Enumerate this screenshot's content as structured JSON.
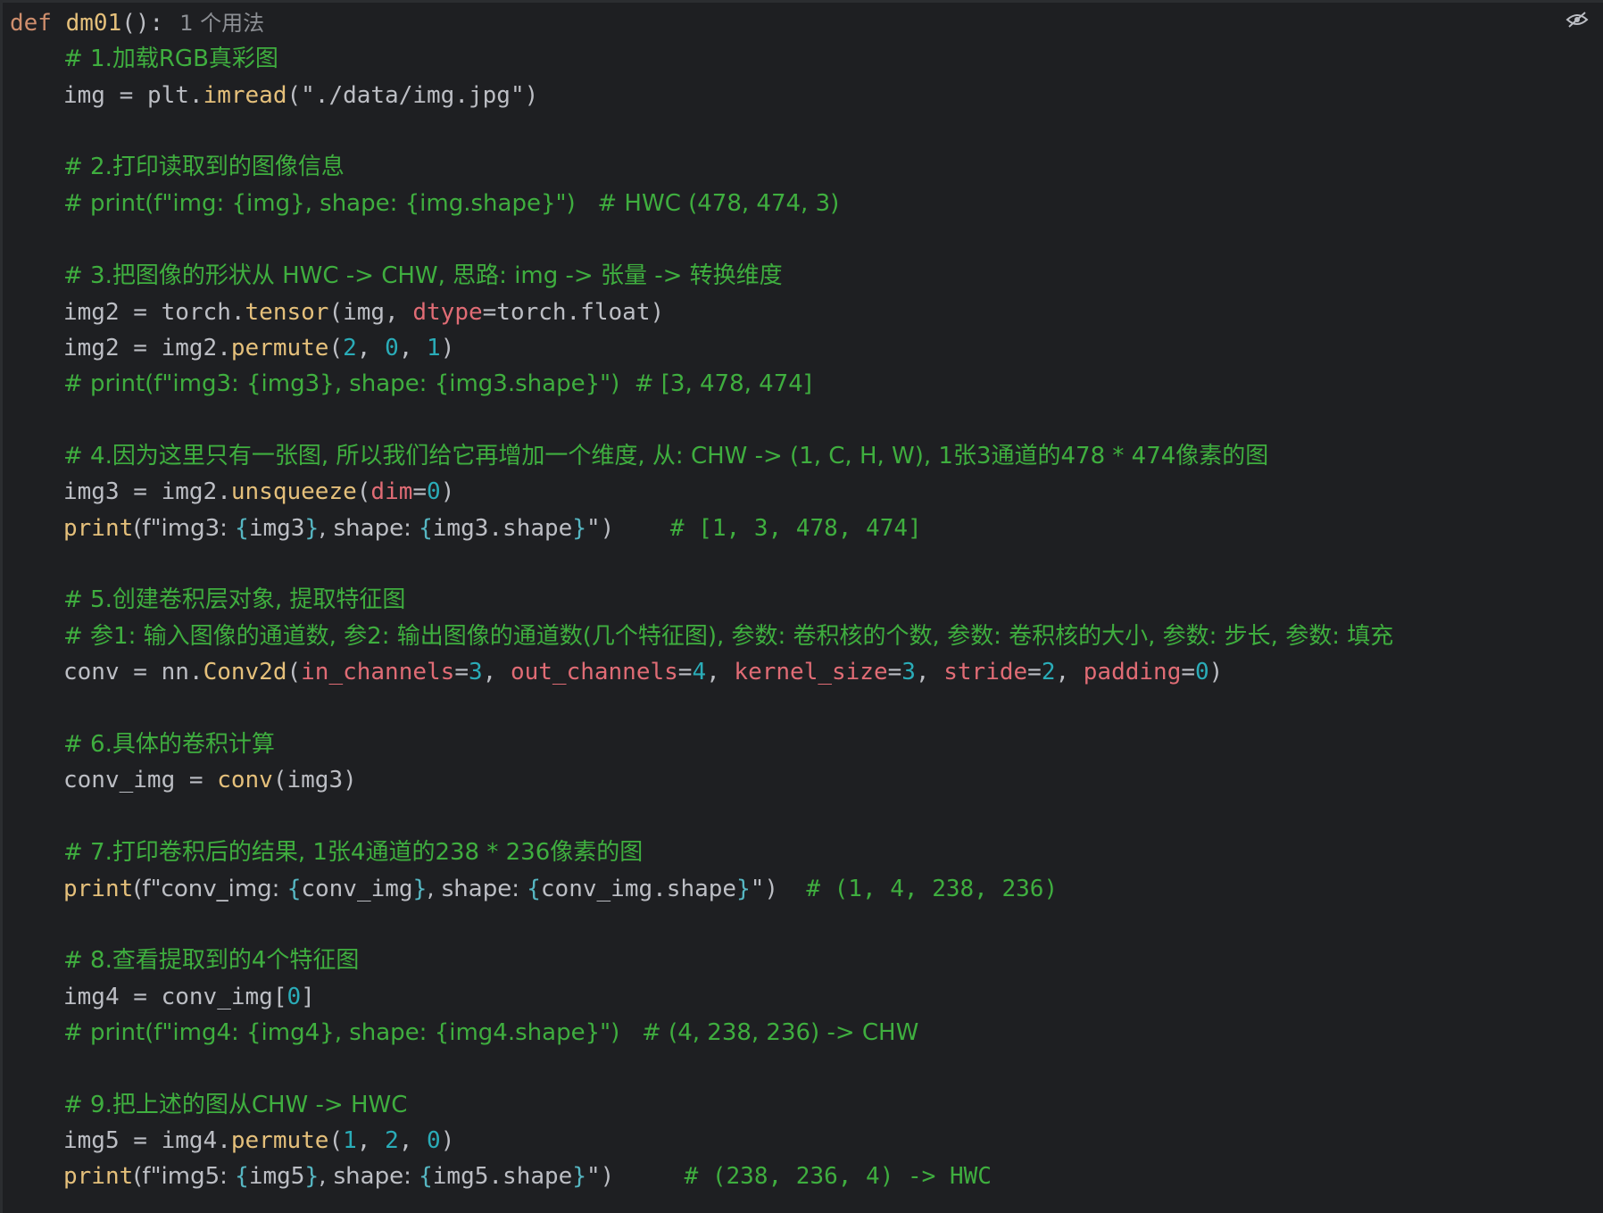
{
  "editor": {
    "def_keyword": "def",
    "func_name": "dm01",
    "func_sig_rest": "():",
    "usage_hint": "1 个用法",
    "lines": {
      "l1_comment": "# 1.加载RGB真彩图",
      "l2_var": "img",
      "l2_eq": " = ",
      "l2_obj": "plt.",
      "l2_call": "imread",
      "l2_args": "(\"./data/img.jpg\")",
      "l3_comment": "# 2.打印读取到的图像信息",
      "l4_comment": "# print(f\"img: {img}, shape: {img.shape}\")   # HWC (478, 474, 3)",
      "l5_comment": "# 3.把图像的形状从 HWC -> CHW, 思路: img -> 张量 -> 转换维度",
      "l6_var": "img2",
      "l6_eq": " = ",
      "l6_obj": "torch.",
      "l6_call": "tensor",
      "l6_open": "(img, ",
      "l6_kw": "dtype",
      "l6_rest": "=torch.float)",
      "l7_var": "img2",
      "l7_eq": " = ",
      "l7_obj": "img2.",
      "l7_call": "permute",
      "l7_open": "(",
      "l7_n1": "2",
      "l7_sep1": ", ",
      "l7_n2": "0",
      "l7_sep2": ", ",
      "l7_n3": "1",
      "l7_close": ")",
      "l8_comment": "# print(f\"img3: {img3}, shape: {img3.shape}\")  # [3, 478, 474]",
      "l9_comment": "# 4.因为这里只有一张图, 所以我们给它再增加一个维度, 从: CHW -> (1, C, H, W), 1张3通道的478 * 474像素的图",
      "l10_var": "img3",
      "l10_eq": " = ",
      "l10_obj": "img2.",
      "l10_call": "unsqueeze",
      "l10_open": "(",
      "l10_kw": "dim",
      "l10_eq2": "=",
      "l10_n": "0",
      "l10_close": ")",
      "l11_print": "print",
      "l11_p1": "(f\"img3: ",
      "l11_b1": "{",
      "l11_v1": "img3",
      "l11_b2": "}",
      "l11_p2": ", shape: ",
      "l11_b3": "{",
      "l11_v2": "img3.shape",
      "l11_b4": "}",
      "l11_p3": "\")",
      "l11_comment": "    # [1, 3, 478, 474]",
      "l12_comment": "# 5.创建卷积层对象, 提取特征图",
      "l13_comment": "# 参1: 输入图像的通道数, 参2: 输出图像的通道数(几个特征图), 参数: 卷积核的个数, 参数: 卷积核的大小, 参数: 步长, 参数: 填充",
      "l14_var": "conv",
      "l14_eq": " = ",
      "l14_obj": "nn.",
      "l14_call": "Conv2d",
      "l14_open": "(",
      "l14_k1": "in_channels",
      "l14_e1": "=",
      "l14_n1": "3",
      "l14_s1": ", ",
      "l14_k2": "out_channels",
      "l14_e2": "=",
      "l14_n2": "4",
      "l14_s2": ", ",
      "l14_k3": "kernel_size",
      "l14_e3": "=",
      "l14_n3": "3",
      "l14_s3": ", ",
      "l14_k4": "stride",
      "l14_e4": "=",
      "l14_n4": "2",
      "l14_s4": ", ",
      "l14_k5": "padding",
      "l14_e5": "=",
      "l14_n5": "0",
      "l14_close": ")",
      "l15_comment": "# 6.具体的卷积计算",
      "l16_var": "conv_img",
      "l16_eq": " = ",
      "l16_call": "conv",
      "l16_args": "(img3)",
      "l17_comment": "# 7.打印卷积后的结果, 1张4通道的238 * 236像素的图",
      "l18_print": "print",
      "l18_p1": "(f\"conv_img: ",
      "l18_b1": "{",
      "l18_v1": "conv_img",
      "l18_b2": "}",
      "l18_p2": ", shape: ",
      "l18_b3": "{",
      "l18_v2": "conv_img.shape",
      "l18_b4": "}",
      "l18_p3": "\")",
      "l18_comment": "  # (1, 4, 238, 236)",
      "l19_comment": "# 8.查看提取到的4个特征图",
      "l20_var": "img4",
      "l20_eq": " = ",
      "l20_obj": "conv_img[",
      "l20_n": "0",
      "l20_close": "]",
      "l21_comment": "# print(f\"img4: {img4}, shape: {img4.shape}\")   # (4, 238, 236) -> CHW",
      "l22_comment": "# 9.把上述的图从CHW -> HWC",
      "l23_var": "img5",
      "l23_eq": " = ",
      "l23_obj": "img4.",
      "l23_call": "permute",
      "l23_open": "(",
      "l23_n1": "1",
      "l23_sep1": ", ",
      "l23_n2": "2",
      "l23_sep2": ", ",
      "l23_n3": "0",
      "l23_close": ")",
      "l24_print": "print",
      "l24_p1": "(f\"img5: ",
      "l24_b1": "{",
      "l24_v1": "img5",
      "l24_b2": "}",
      "l24_p2": ", shape: ",
      "l24_b3": "{",
      "l24_v2": "img5.shape",
      "l24_b4": "}",
      "l24_p3": "\")",
      "l24_comment": "     # (238, 236, 4) -> HWC"
    }
  },
  "icons": {
    "reader_mode": "eye-slash-icon"
  },
  "colors": {
    "background": "#1e1f22",
    "keyword": "#cf8e6d",
    "function": "#56a8f5",
    "comment": "#3fae3f",
    "number": "#2aacb8",
    "kwarg": "#e06c75",
    "builtin": "#e5c07b"
  }
}
